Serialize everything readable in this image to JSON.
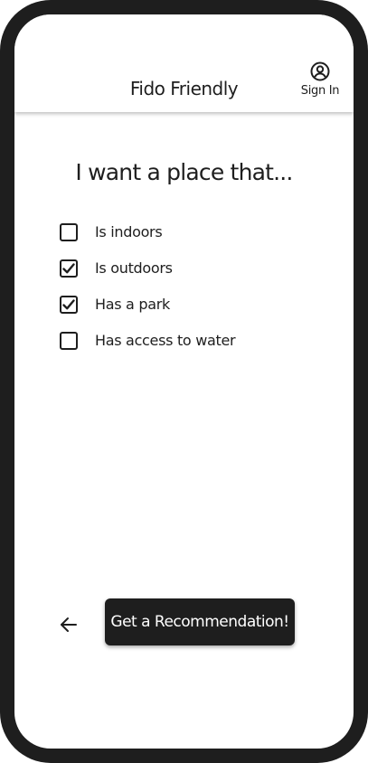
{
  "header": {
    "title": "Fido Friendly",
    "sign_in_label": "Sign In",
    "sign_in_icon": "user-circle-icon"
  },
  "main": {
    "question": "I want a place that...",
    "options": [
      {
        "label": "Is indoors",
        "checked": false
      },
      {
        "label": "Is outdoors",
        "checked": true
      },
      {
        "label": "Has a park",
        "checked": true
      },
      {
        "label": "Has access to water",
        "checked": false
      }
    ]
  },
  "footer": {
    "back_icon": "arrow-left-icon",
    "cta_label": "Get a Recommendation!"
  },
  "colors": {
    "primary": "#1e1e1e",
    "background": "#ffffff"
  }
}
